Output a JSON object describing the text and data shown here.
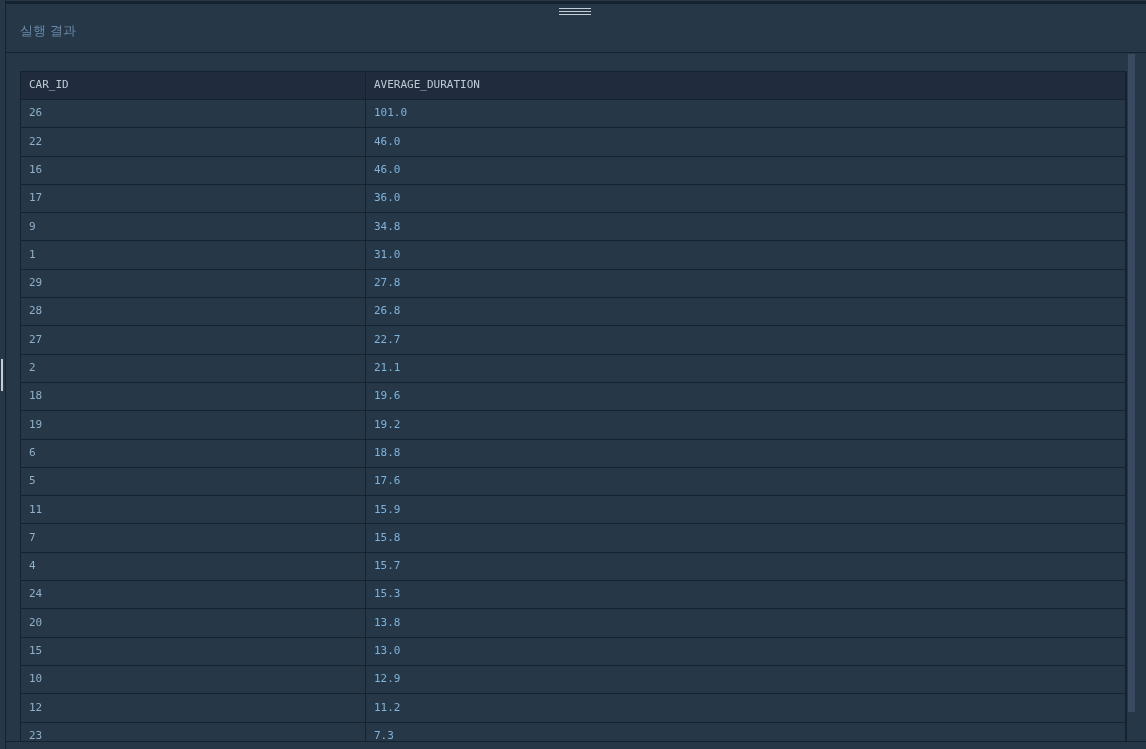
{
  "panel": {
    "title": "실행 결과"
  },
  "table": {
    "columns": [
      "CAR_ID",
      "AVERAGE_DURATION"
    ],
    "rows": [
      [
        "26",
        "101.0"
      ],
      [
        "22",
        "46.0"
      ],
      [
        "16",
        "46.0"
      ],
      [
        "17",
        "36.0"
      ],
      [
        "9",
        "34.8"
      ],
      [
        "1",
        "31.0"
      ],
      [
        "29",
        "27.8"
      ],
      [
        "28",
        "26.8"
      ],
      [
        "27",
        "22.7"
      ],
      [
        "2",
        "21.1"
      ],
      [
        "18",
        "19.6"
      ],
      [
        "19",
        "19.2"
      ],
      [
        "6",
        "18.8"
      ],
      [
        "5",
        "17.6"
      ],
      [
        "11",
        "15.9"
      ],
      [
        "7",
        "15.8"
      ],
      [
        "4",
        "15.7"
      ],
      [
        "24",
        "15.3"
      ],
      [
        "20",
        "13.8"
      ],
      [
        "15",
        "13.0"
      ],
      [
        "10",
        "12.9"
      ],
      [
        "12",
        "11.2"
      ],
      [
        "23",
        "7.3"
      ]
    ]
  }
}
